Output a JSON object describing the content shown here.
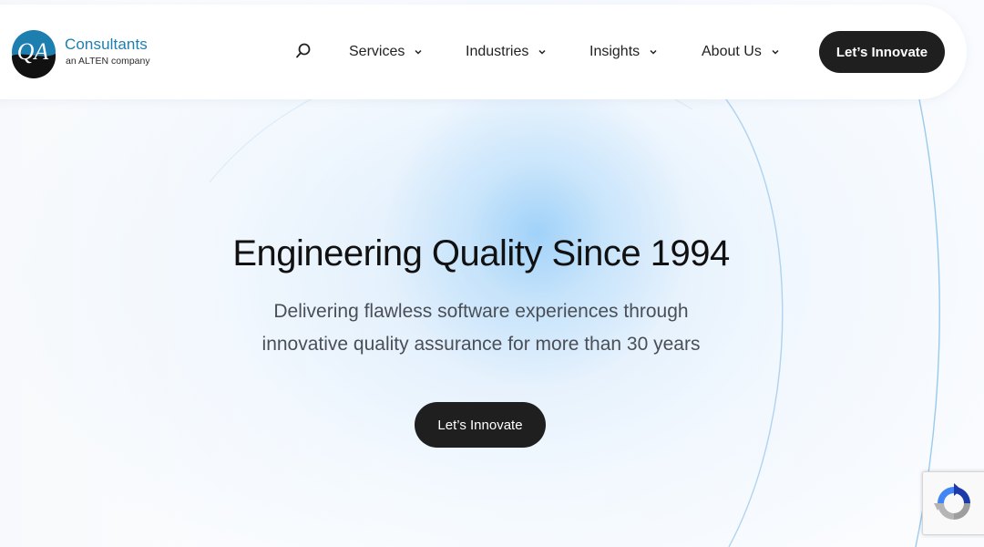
{
  "brand": {
    "logo_mark_text": "QA",
    "name": "Consultants",
    "tagline": "an ALTEN company"
  },
  "nav": {
    "items": [
      {
        "label": "Services"
      },
      {
        "label": "Industries"
      },
      {
        "label": "Insights"
      },
      {
        "label": "About Us"
      }
    ],
    "search_icon": "search-icon",
    "chevron_icon": "chevron-down-icon",
    "cta_label": "Let’s Innovate"
  },
  "hero": {
    "title": "Engineering Quality Since 1994",
    "subtitle_line1": "Delivering flawless software experiences through",
    "subtitle_line2": "innovative quality assurance for more than 30 years",
    "cta_label": "Let’s Innovate"
  },
  "widgets": {
    "recaptcha_icon": "recaptcha-icon"
  },
  "colors": {
    "brand_blue": "#1d7fb0",
    "button_dark": "#1f1f1f",
    "hero_glow": "#9ccdf6"
  }
}
